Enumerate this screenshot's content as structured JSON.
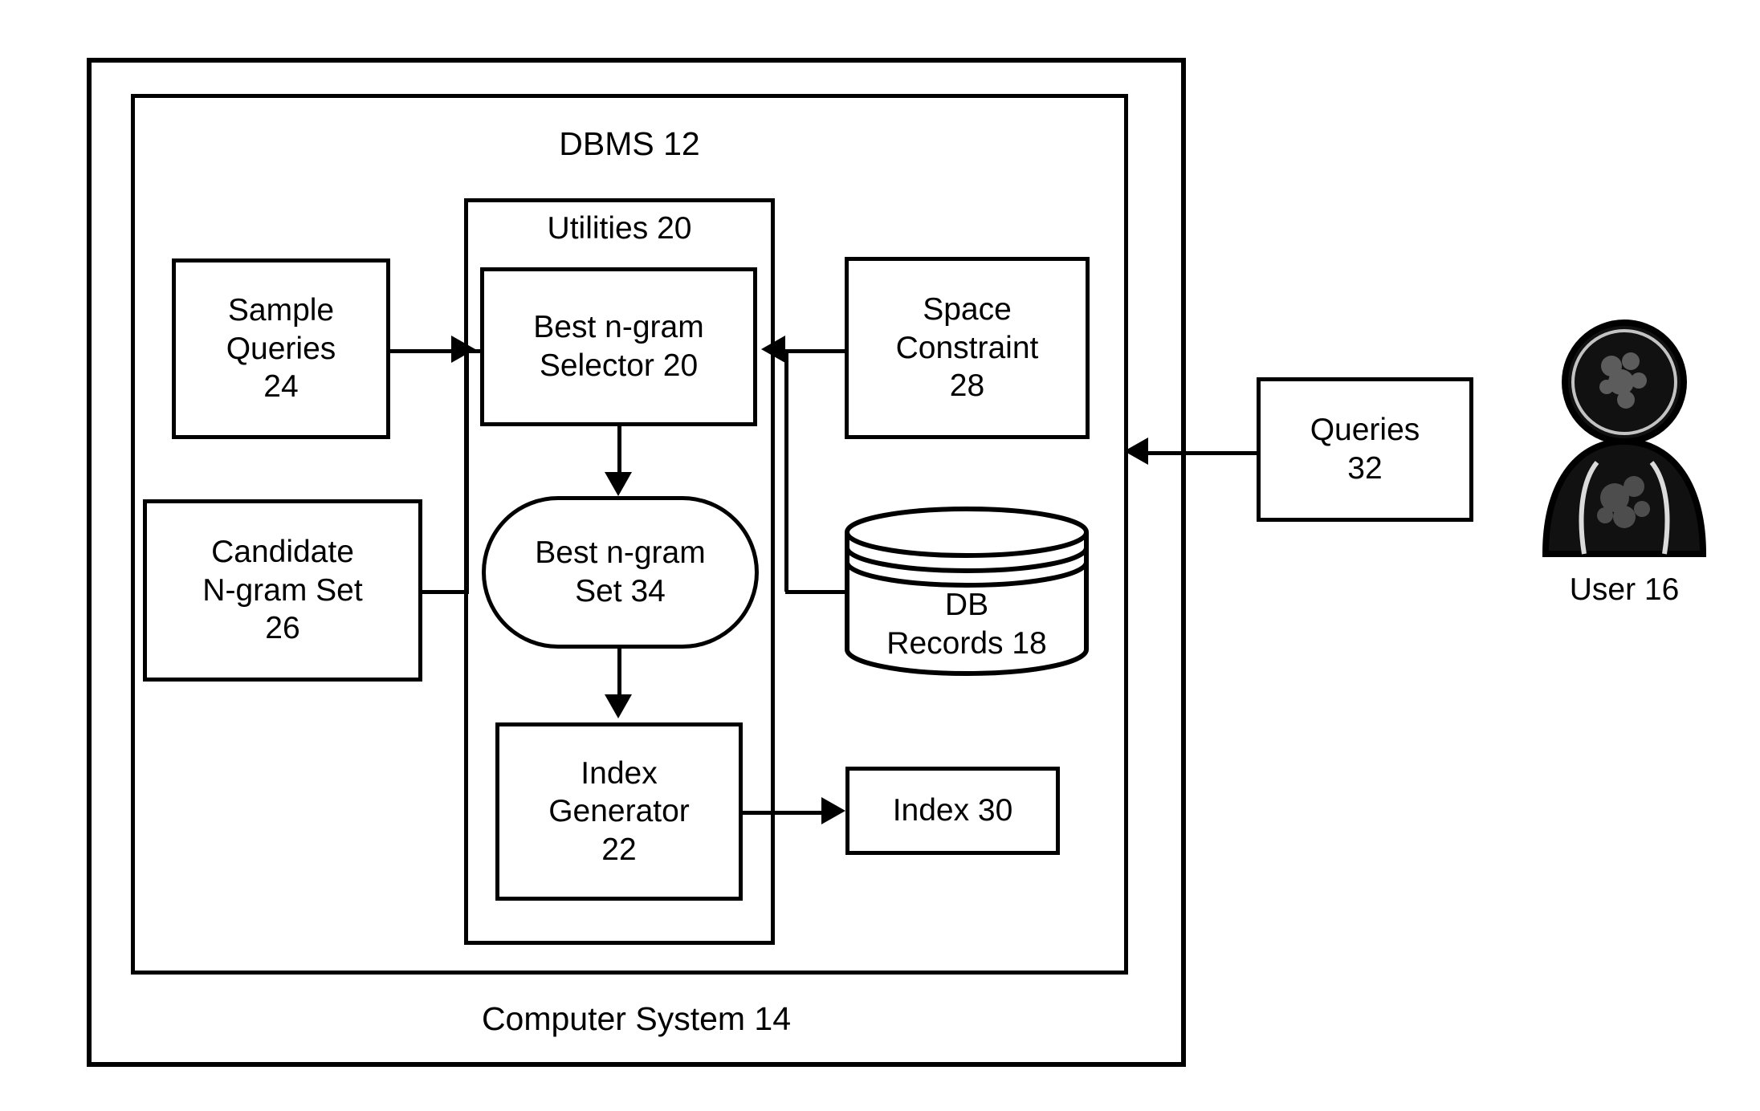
{
  "figure": {
    "type": "patent-block-diagram",
    "outer_container_label": "Computer System 14",
    "inner_container_label": "DBMS 12",
    "utilities_label": "Utilities 20"
  },
  "nodes": {
    "sample_queries": {
      "line1": "Sample",
      "line2": "Queries",
      "line3": "24"
    },
    "candidate_ngram_set": {
      "line1": "Candidate",
      "line2": "N-gram Set",
      "line3": "26"
    },
    "best_ngram_selector": {
      "line1": "Best n-gram",
      "line2": "Selector 20"
    },
    "space_constraint": {
      "line1": "Space",
      "line2": "Constraint",
      "line3": "28"
    },
    "best_ngram_set": {
      "line1": "Best n-gram",
      "line2": "Set 34"
    },
    "db_records": {
      "line1": "DB",
      "line2": "Records 18"
    },
    "index_generator": {
      "line1": "Index",
      "line2": "Generator",
      "line3": "22"
    },
    "index": {
      "line1": "Index 30"
    },
    "queries": {
      "line1": "Queries",
      "line2": "32"
    },
    "user": {
      "label": "User 16",
      "icon": "user-person-icon"
    }
  },
  "colors": {
    "stroke": "#000000",
    "background": "#ffffff",
    "user_fill": "#111111"
  }
}
